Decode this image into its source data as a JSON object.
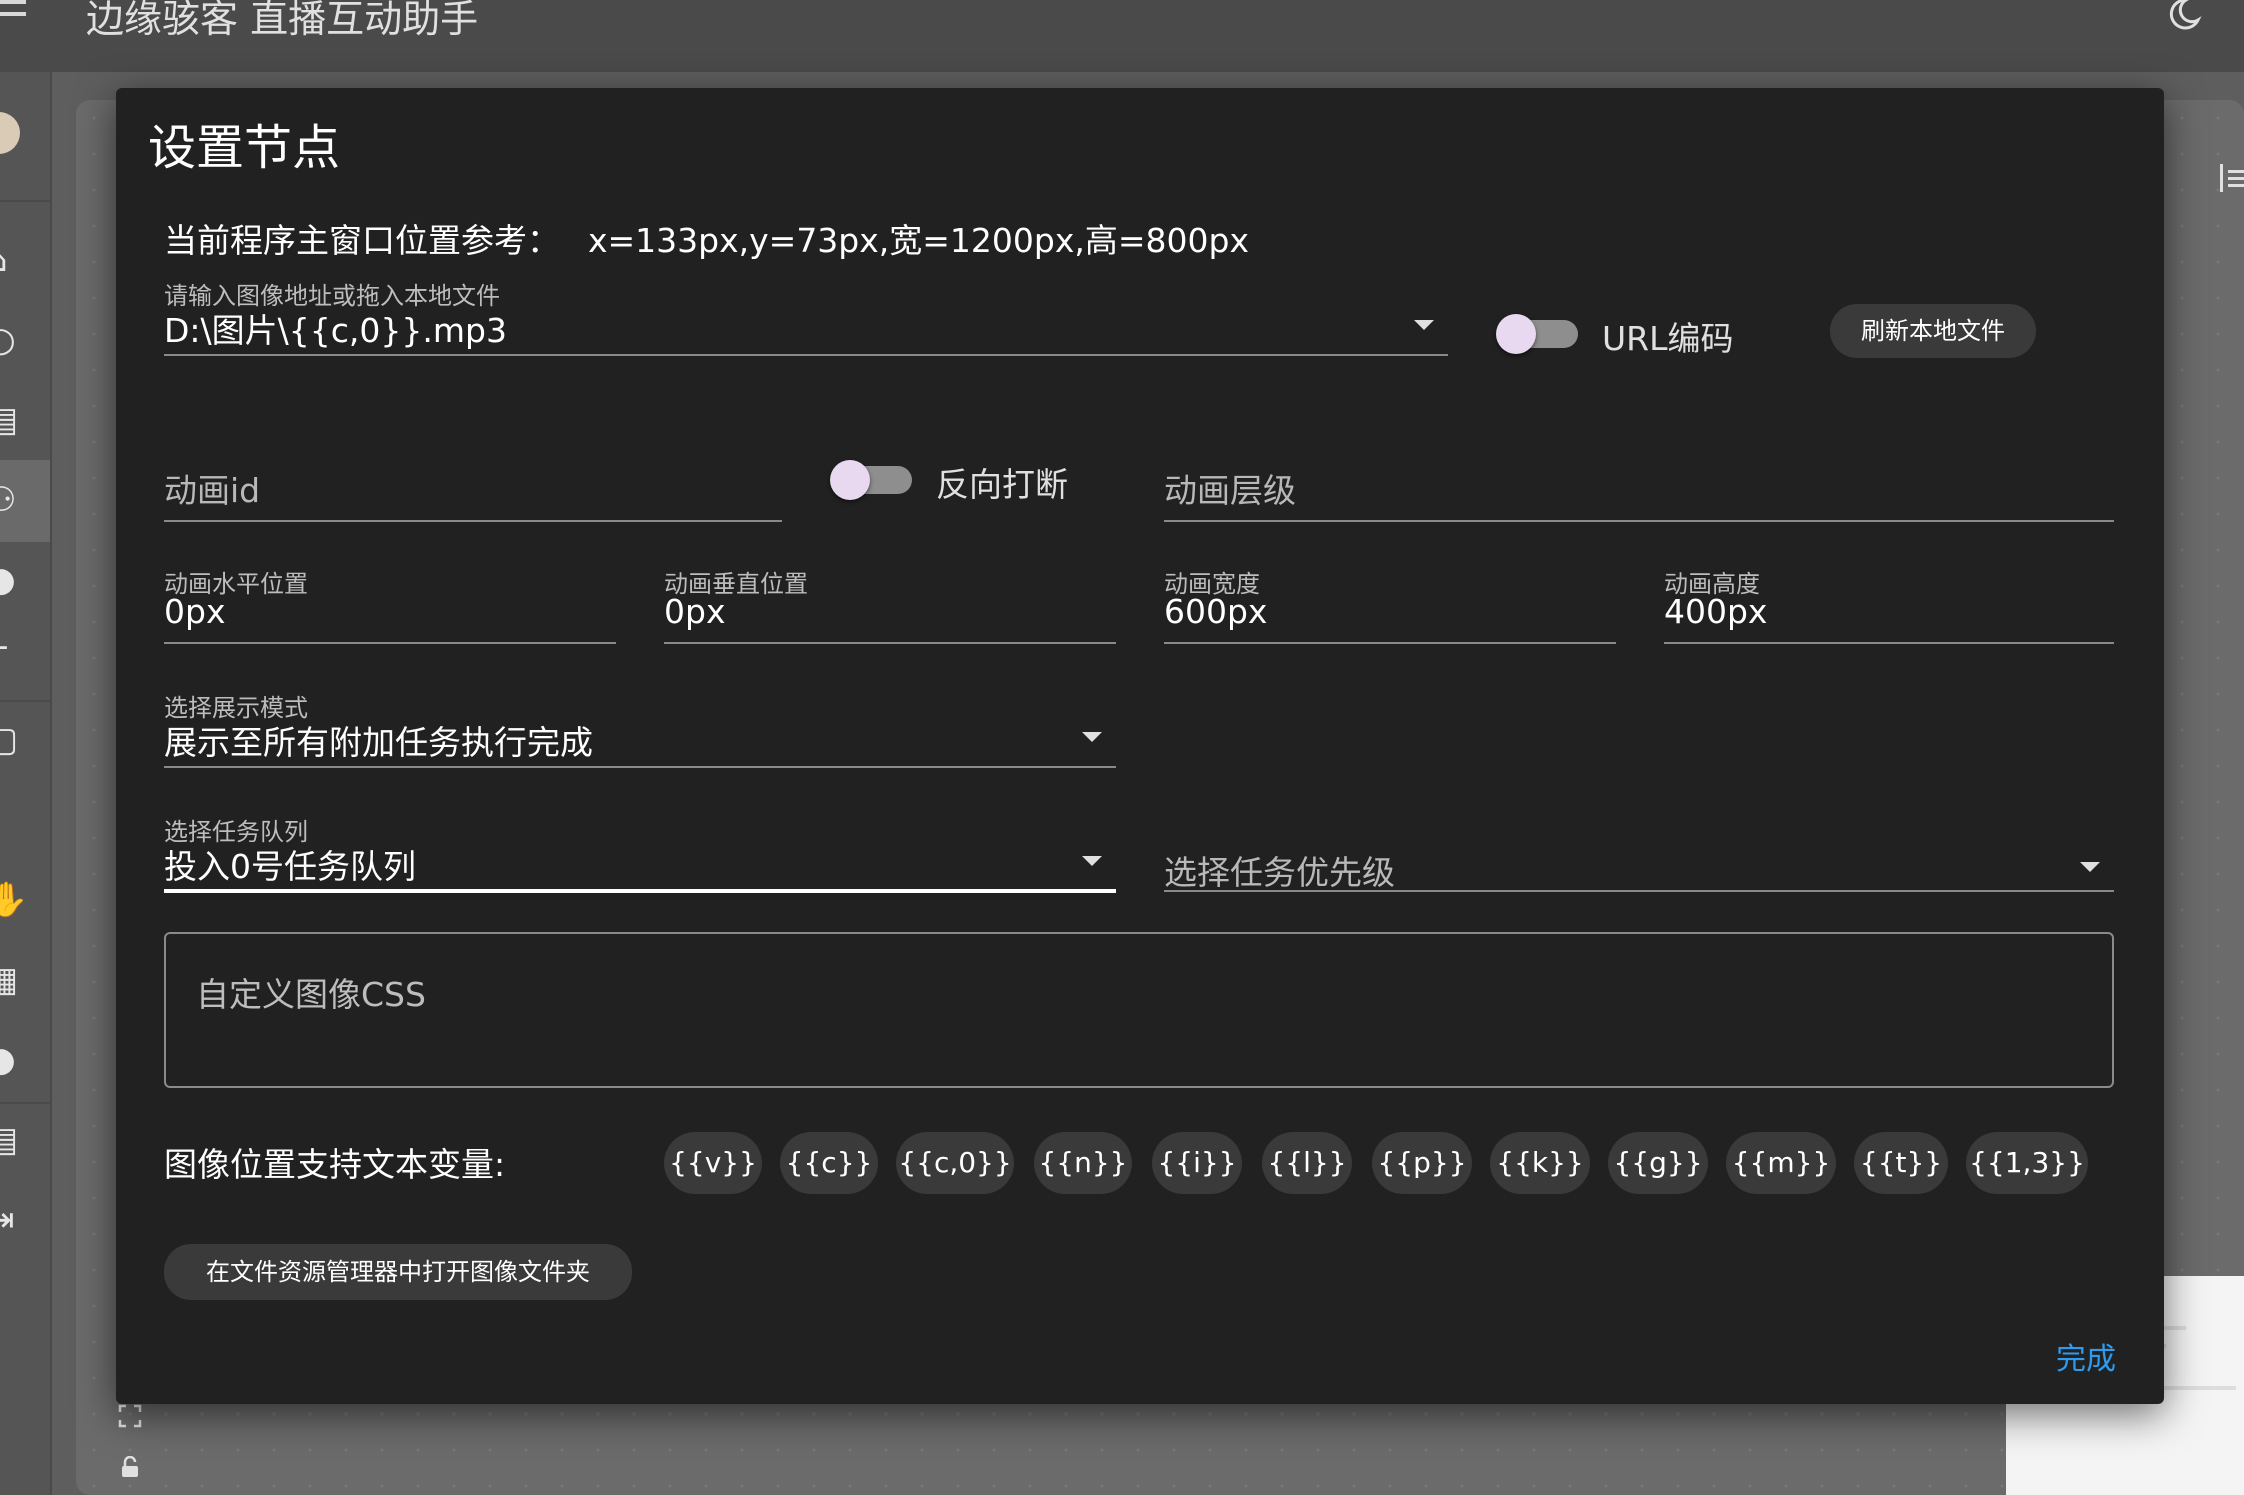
{
  "appbar": {
    "title": "边缘骇客 直播互动助手",
    "menu_icon": "hamburger-menu-icon",
    "theme_icon": "moon-theme-icon"
  },
  "sidebar": {
    "icons": [
      "avatar",
      "home-icon",
      "link-icon",
      "list-icon",
      "nodes-icon",
      "circle-icon",
      "text-icon",
      "frame-icon",
      "alert-icon",
      "hand-icon",
      "grid-icon",
      "info-icon",
      "doc-icon",
      "exit-icon"
    ]
  },
  "dialog": {
    "title": "设置节点",
    "ref_label": "当前程序主窗口位置参考：",
    "ref_value": "x=133px,y=73px,宽=1200px,高=800px",
    "image_url": {
      "label": "请输入图像地址或拖入本地文件",
      "value": "D:\\图片\\{{c,0}}.mp3"
    },
    "url_encode_label": "URL编码",
    "refresh_button": "刷新本地文件",
    "anim_id_placeholder": "动画id",
    "reverse_break_label": "反向打断",
    "anim_layer_placeholder": "动画层级",
    "anim_h_pos": {
      "label": "动画水平位置",
      "value": "0px"
    },
    "anim_v_pos": {
      "label": "动画垂直位置",
      "value": "0px"
    },
    "anim_width": {
      "label": "动画宽度",
      "value": "600px"
    },
    "anim_height": {
      "label": "动画高度",
      "value": "400px"
    },
    "display_mode": {
      "label": "选择展示模式",
      "value": "展示至所有附加任务执行完成"
    },
    "task_queue": {
      "label": "选择任务队列",
      "value": "投入0号任务队列"
    },
    "task_priority_placeholder": "选择任务优先级",
    "css_placeholder": "自定义图像CSS",
    "vars_label": "图像位置支持文本变量:",
    "vars": [
      "{{v}}",
      "{{c}}",
      "{{c,0}}",
      "{{n}}",
      "{{i}}",
      "{{l}}",
      "{{p}}",
      "{{k}}",
      "{{g}}",
      "{{m}}",
      "{{t}}",
      "{{1,3}}"
    ],
    "open_folder_button": "在文件资源管理器中打开图像文件夹",
    "done_button": "完成"
  },
  "colors": {
    "dialog_bg": "#212121",
    "page_bg": "#5e5e5e",
    "accent": "#2e9bf0",
    "switch_thumb": "#e8d8f0"
  }
}
